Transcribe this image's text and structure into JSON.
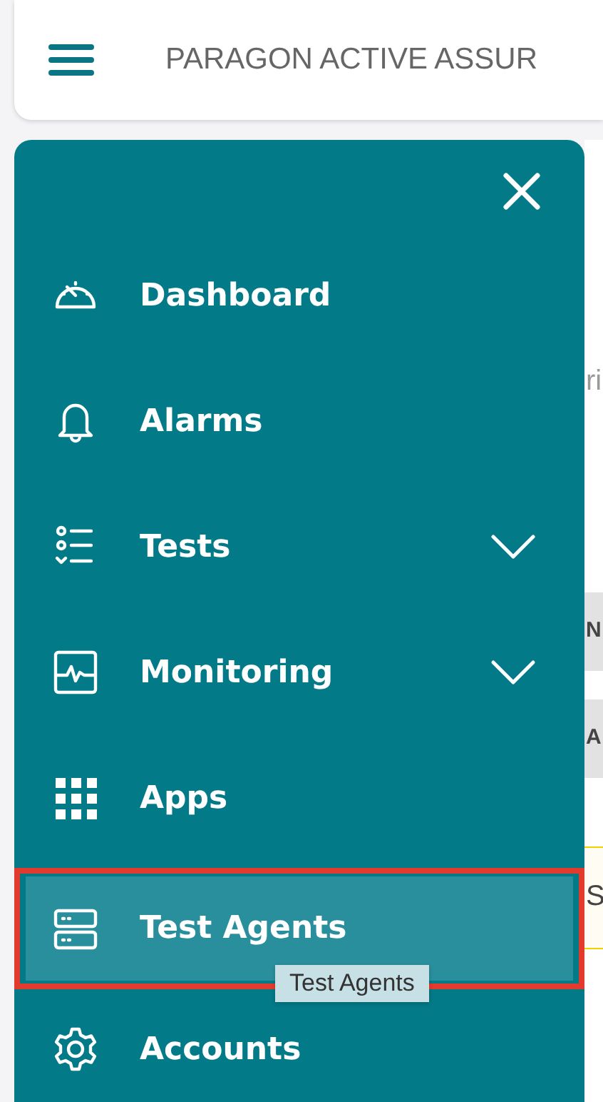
{
  "header": {
    "title": "PARAGON ACTIVE ASSUR"
  },
  "background_fragments": [
    {
      "text": "ri",
      "kind": "plain"
    },
    {
      "text": "N",
      "kind": "bar"
    },
    {
      "text": "A",
      "kind": "bar"
    },
    {
      "text": "S",
      "kind": "framed"
    }
  ],
  "menu": {
    "items": [
      {
        "label": "Dashboard",
        "kind": "link",
        "selected": false
      },
      {
        "label": "Alarms",
        "kind": "link",
        "selected": false
      },
      {
        "label": "Tests",
        "kind": "group",
        "expanded": false,
        "selected": false
      },
      {
        "label": "Monitoring",
        "kind": "group",
        "expanded": false,
        "selected": false
      },
      {
        "label": "Apps",
        "kind": "link",
        "selected": false
      },
      {
        "label": "Test Agents",
        "kind": "link",
        "selected": true,
        "tooltip": "Test Agents"
      },
      {
        "label": "Accounts",
        "kind": "link",
        "selected": false
      }
    ]
  }
}
